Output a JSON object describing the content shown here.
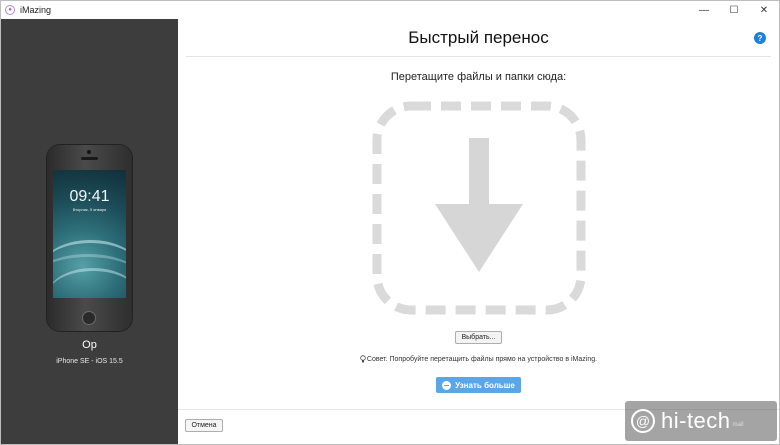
{
  "window": {
    "app_title": "iMazing",
    "controls": {
      "minimize": "—",
      "maximize": "☐",
      "close": "✕"
    }
  },
  "sidebar": {
    "device": {
      "lock_time": "09:41",
      "lock_date": "Вторник, 9 января",
      "name": "Op",
      "model": "iPhone SE - iOS 15.5"
    }
  },
  "main": {
    "title": "Быстрый перенос",
    "help_label": "?",
    "drop_heading": "Перетащите файлы и папки сюда:",
    "choose_label": "Выбрать...",
    "tip_text": "Совет. Попробуйте перетащить файлы прямо на устройство в iMazing.",
    "learn_more_label": "Узнать больше",
    "cancel_label": "Отмена"
  },
  "watermark": {
    "symbol": "@",
    "text": "hi-tech",
    "sub": "mail"
  },
  "colors": {
    "sidebar_bg": "#3d3d3d",
    "accent": "#5aa6e6",
    "help": "#1f7fd9",
    "drop_zone": "#dadada"
  },
  "icons": {
    "app": "imazing-logo-icon",
    "help": "help-icon",
    "drop": "arrow-down-icon",
    "tip": "lightbulb-icon",
    "learn_more": "chat-bubble-icon"
  }
}
